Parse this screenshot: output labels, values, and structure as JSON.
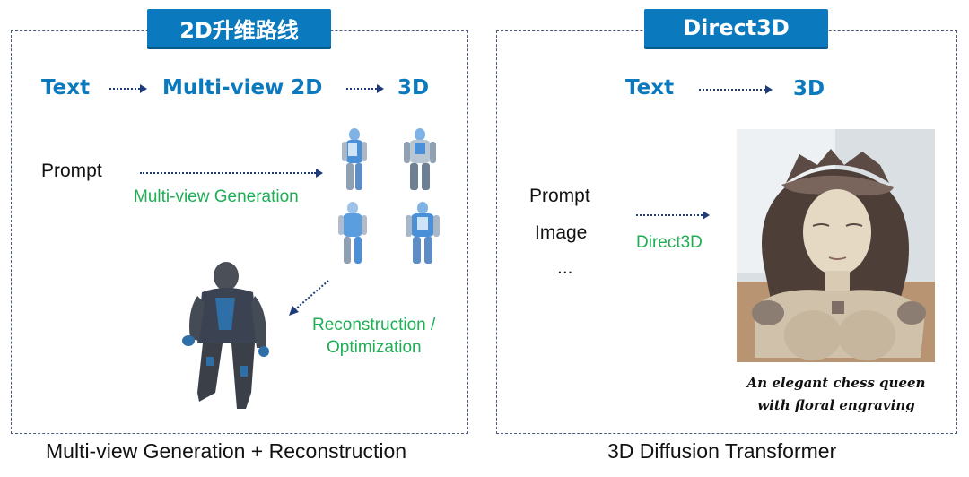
{
  "left_panel": {
    "tag_label": "2D升维路线",
    "flow": [
      "Text",
      "Multi-view 2D",
      "3D"
    ],
    "prompt_label": "Prompt",
    "multiview_label": "Multi-view Generation",
    "reconstruction_label_line1": "Reconstruction /",
    "reconstruction_label_line2": "Optimization",
    "caption": "Multi-view Generation + Reconstruction",
    "multiview_images": [
      "robot-side-view",
      "robot-front-view",
      "robot-back-view",
      "robot-rear-front-view"
    ],
    "result_image": "reconstructed-3d-robot"
  },
  "right_panel": {
    "tag_label": "Direct3D",
    "flow": [
      "Text",
      "3D"
    ],
    "inputs": [
      "Prompt",
      "Image",
      "..."
    ],
    "method_label": "Direct3D",
    "result_image": "chess-queen-bust",
    "image_caption_line1": "An elegant chess queen",
    "image_caption_line2": "with floral engraving",
    "caption": "3D Diffusion Transformer"
  },
  "colors": {
    "accent_blue": "#0a79bd",
    "green": "#1fae55",
    "arrow": "#1f3c78"
  }
}
